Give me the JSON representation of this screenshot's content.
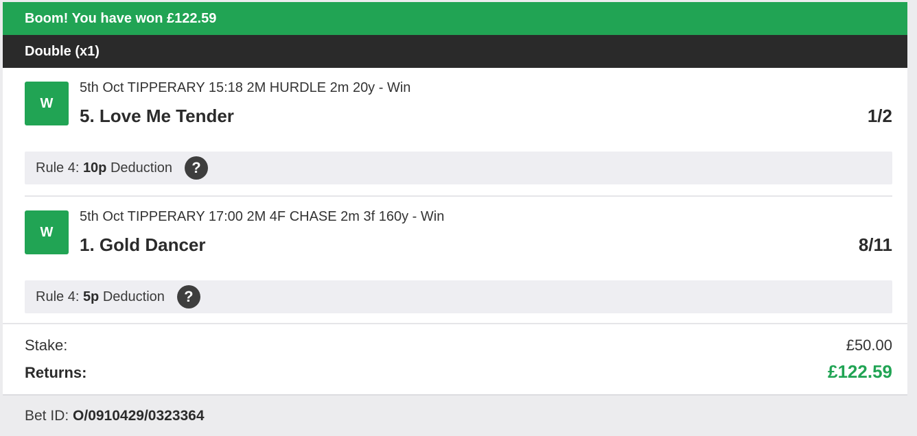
{
  "banner": {
    "text": "Boom! You have won £122.59"
  },
  "bet_type": {
    "text": "Double (x1)"
  },
  "legs": [
    {
      "badge": "W",
      "event": "5th Oct TIPPERARY 15:18 2M HURDLE 2m 20y - Win",
      "selection": "5. Love Me Tender",
      "odds": "1/2",
      "rule4_prefix": "Rule 4: ",
      "rule4_amount": "10p",
      "rule4_suffix": " Deduction",
      "help": "?"
    },
    {
      "badge": "W",
      "event": "5th Oct TIPPERARY 17:00 2M 4F CHASE 2m 3f 160y - Win",
      "selection": "1. Gold Dancer",
      "odds": "8/11",
      "rule4_prefix": "Rule 4: ",
      "rule4_amount": "5p",
      "rule4_suffix": " Deduction",
      "help": "?"
    }
  ],
  "summary": {
    "stake_label": "Stake:",
    "stake_value": "£50.00",
    "returns_label": "Returns:",
    "returns_value": "£122.59"
  },
  "footer": {
    "bet_id_label": "Bet ID: ",
    "bet_id_value": "O/0910429/0323364"
  },
  "colors": {
    "win_green": "#21a454",
    "header_dark": "#2a2a2a",
    "rule4_bg": "#eeeef2"
  }
}
